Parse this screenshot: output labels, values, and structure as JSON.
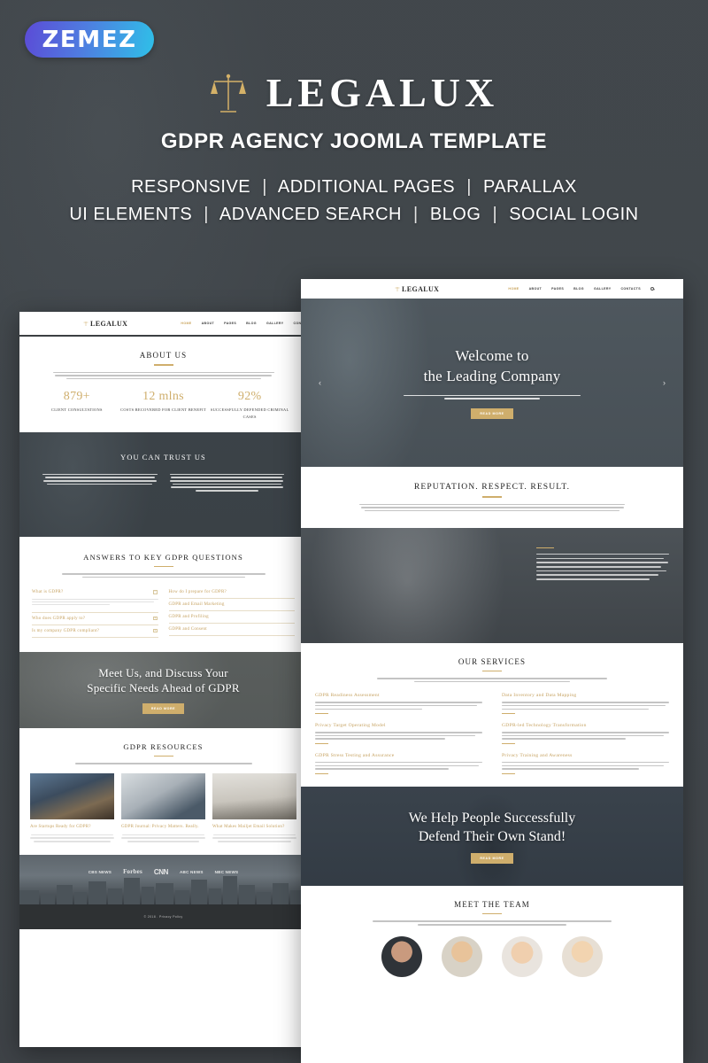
{
  "hero": {
    "vendor_badge": "ZEMEZ",
    "brand": "LEGALUX",
    "subtitle": "GDPR AGENCY  JOOMLA TEMPLATE",
    "features_row1": [
      "RESPONSIVE",
      "ADDITIONAL PAGES",
      "PARALLAX"
    ],
    "features_row2": [
      "UI ELEMENTS",
      "ADVANCED SEARCH",
      "BLOG",
      "SOCIAL LOGIN"
    ],
    "separator": "|",
    "colors": {
      "gold": "#cfae6c",
      "badge_start": "#5b4bd6",
      "badge_end": "#2fc0e8",
      "text": "#ffffff"
    }
  },
  "nav": {
    "logo": "LEGALUX",
    "items": [
      "HOME",
      "ABOUT",
      "PAGES",
      "BLOG",
      "GALLERY",
      "CONTACTS"
    ],
    "active": "HOME",
    "search_icon": "search-icon"
  },
  "left_preview": {
    "about": {
      "title": "ABOUT US",
      "description": "The Legalux is among the largest, most well-established and respected firms serving North Carolina residents and businesses. Since 1927 we have provided strategic legal counsel and services to meet clients' personal, estate planning, corporate, business and litigation needs. We dedicate ourselves to being more than legal representatives.",
      "stats": [
        {
          "number": "879+",
          "label": "CLIENT CONSULTATIONS"
        },
        {
          "number": "12 mlns",
          "label": "COSTS RECOVERED FOR CLIENT BENEFIT"
        },
        {
          "number": "92%",
          "label": "SUCCESSFULLY DEFENDED CRIMINAL CASES"
        }
      ]
    },
    "trust": {
      "title": "YOU CAN TRUST US",
      "col1": "Every case is different. Past results are in no way intended to imply that similar results can be obtained in a case that past lawyers do and only a firm's experience when it comes to serious catastrophic injury and wrongful death cases.",
      "col2": "Our attorneys represent clients in a variety of practice areas including car accident, birth injury, brain injury, dog bite, product, drug injury, motorcycle accident, nursing home abuse, personal injury, Social Security disability, spinal injury, traffic ticket, truck accident, workers compensation and wrongful death."
    },
    "faq": {
      "title": "ANSWERS TO KEY GDPR QUESTIONS",
      "description": "As organisations get to grips with their GDPR obligations, BAE Systems believes the regulation can be an opportunity rather than a burden if addressed in the right way.",
      "left_items": [
        {
          "q": "What is GDPR?",
          "open": true,
          "answer": "GDPR is a regulation by which the European Parliament, the Council of the European Union and the European Commission intend to strengthen and unify data protection for EU residents."
        },
        {
          "q": "Who does GDPR apply to?",
          "open": false
        },
        {
          "q": "Is my company GDPR compliant?",
          "open": false
        }
      ],
      "right_items": [
        {
          "q": "How do I prepare for GDPR?"
        },
        {
          "q": "GDPR and Email Marketing"
        },
        {
          "q": "GDPR and Profiling"
        },
        {
          "q": "GDPR and Consent"
        }
      ]
    },
    "cta": {
      "heading_line1": "Meet Us, and Discuss Your",
      "heading_line2": "Specific Needs Ahead of GDPR",
      "button": "READ MORE"
    },
    "resources": {
      "title": "GDPR RESOURCES",
      "description": "We've created a variety of resources around GDPR and email.",
      "cards": [
        {
          "title": "Are Startups Ready for GDPR?",
          "excerpt": "It's finally here. After several months of preparation this week the General Data Protection Regulations (GDPR) finally comes into effect."
        },
        {
          "title": "GDPR Journal: Privacy Matters. Really.",
          "excerpt": "As our resident legal expert here at Mailjet, I set aside at least a half day each week to take care of our data privacy issues."
        },
        {
          "title": "What Makes Mailjet Email Solution?",
          "excerpt": "In the age of big data, email plays the day-to-day management of any business, whether it be sending marketing."
        }
      ]
    },
    "press_logos": [
      "CBS NEWS",
      "Forbes",
      "CNN",
      "ABC NEWS",
      "NBC NEWS"
    ],
    "footer": "© 2018 . Privacy Policy"
  },
  "right_preview": {
    "hero": {
      "heading_line1": "Welcome to",
      "heading_line2": "the Leading Company",
      "subtext": "Providing timely, creative, cost-effective legal solutions. You can expect to get an answer to most of your site questions immediately.",
      "button": "READ MORE",
      "prev_arrow": "‹",
      "next_arrow": "›"
    },
    "reputation": {
      "title": "REPUTATION. RESPECT. RESULT.",
      "description": "The General Data Protection Regulation (GDPR) puts regulatory teeth into longstanding governmental guidance about how EU member states handle personally identifiable information. This level of regulatory oversight of personal data is unprecedented and will require companies to ensure the highest levels of of privacy protection or suffer dire financial consequences."
    },
    "aim": {
      "text": "The aim of the GDPR is to protect all EU citizens from privacy and data breaches in an increasingly data-driven world that is vastly different from the time in which the 1995 directive was established. Although the key principles of data privacy still hold true to the previous directive, many changes have been proposed to the regulatory policies."
    },
    "services": {
      "title": "OUR SERVICES",
      "description": "Our help consists in both preparation and implementation of personal data protection procedures as well as fine-tuning your security policies.",
      "items": [
        {
          "title": "GDPR Readiness Assessment",
          "text": "Conduct a targeted assessment to understand your existing data privacy posture, identify potential GDPR compliance gaps and high risk areas to meet your regulatory obligations."
        },
        {
          "title": "Data Inventory and Data Mapping",
          "text": "Execute a detailed data inventory and data mapping exercise driving the identification of your critical data assets and corresponding data flows, enabling you to focus security and privacy efforts where it matters."
        },
        {
          "title": "Privacy Target Operating Model",
          "text": "Establish a robust privacy policy and process framework, enabled by supporting technology, with competence governance and oversight to drive the effective implementation of your privacy strategy."
        },
        {
          "title": "GDPR-led Technology Transformation",
          "text": "Design and implement technology solutions or changes to the existing technology landscape in order to help you meet your GDPR obligations through appropriate tooling, including but not limited to data."
        },
        {
          "title": "GDPR Stress Testing and Assurance",
          "text": "Provide comprehensive GDPR programme assurance services, as well as simulated GDPR stress testing including data breach simulation and incident management process review, subject rights testing."
        },
        {
          "title": "Privacy Training and Awareness",
          "text": "Leverage a user centric approach to communication, education and services design to develop a tailored GDPR training and communication plan which will enable you to build a privacy first culture and drive."
        }
      ]
    },
    "defend": {
      "heading_line1": "We Help People Successfully",
      "heading_line2": "Defend Their Own Stand!",
      "button": "READ MORE"
    },
    "team": {
      "title": "MEET THE TEAM",
      "description": "There's a reason that our reputation precedes us: our 20-year history in San Diego has garnered us some of the top reviews in the personal injury industry.",
      "members": [
        "member-1",
        "member-2",
        "member-3",
        "member-4"
      ]
    }
  }
}
